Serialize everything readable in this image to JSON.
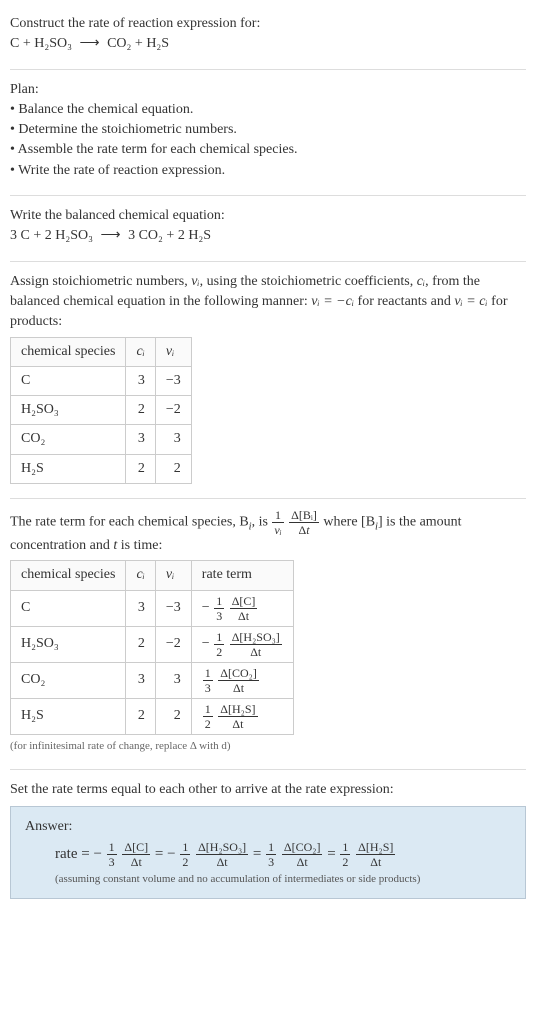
{
  "intro": {
    "title": "Construct the rate of reaction expression for:",
    "equation_lhs": "C + H₂SO₃",
    "equation_rhs": "CO₂ + H₂S"
  },
  "plan": {
    "heading": "Plan:",
    "items": [
      "Balance the chemical equation.",
      "Determine the stoichiometric numbers.",
      "Assemble the rate term for each chemical species.",
      "Write the rate of reaction expression."
    ]
  },
  "balanced": {
    "heading": "Write the balanced chemical equation:",
    "equation_lhs": "3 C + 2 H₂SO₃",
    "equation_rhs": "3 CO₂ + 2 H₂S"
  },
  "stoich": {
    "intro_a": "Assign stoichiometric numbers, ",
    "intro_b": ", using the stoichiometric coefficients, ",
    "intro_c": ", from the balanced chemical equation in the following manner: ",
    "intro_d": " for reactants and ",
    "intro_e": " for products:",
    "table": {
      "h1": "chemical species",
      "h2": "cᵢ",
      "h3": "νᵢ",
      "rows": [
        {
          "sp": "C",
          "c": "3",
          "v": "−3"
        },
        {
          "sp": "H₂SO₃",
          "c": "2",
          "v": "−2"
        },
        {
          "sp": "CO₂",
          "c": "3",
          "v": "3"
        },
        {
          "sp": "H₂S",
          "c": "2",
          "v": "2"
        }
      ]
    }
  },
  "rateterm": {
    "intro_a": "The rate term for each chemical species, B",
    "intro_b": ", is ",
    "intro_c": " where [B",
    "intro_d": "] is the amount concentration and ",
    "intro_e": " is time:",
    "table": {
      "h1": "chemical species",
      "h2": "cᵢ",
      "h3": "νᵢ",
      "h4": "rate term",
      "rows": [
        {
          "sp": "C",
          "c": "3",
          "v": "−3",
          "sign": "−",
          "coef": "3",
          "delta": "Δ[C]"
        },
        {
          "sp": "H₂SO₃",
          "c": "2",
          "v": "−2",
          "sign": "−",
          "coef": "2",
          "delta": "Δ[H₂SO₃]"
        },
        {
          "sp": "CO₂",
          "c": "3",
          "v": "3",
          "sign": "",
          "coef": "3",
          "delta": "Δ[CO₂]"
        },
        {
          "sp": "H₂S",
          "c": "2",
          "v": "2",
          "sign": "",
          "coef": "2",
          "delta": "Δ[H₂S]"
        }
      ]
    },
    "note": "(for infinitesimal rate of change, replace Δ with d)"
  },
  "final": {
    "heading": "Set the rate terms equal to each other to arrive at the rate expression:",
    "answer_label": "Answer:",
    "rate_prefix": "rate = ",
    "terms": [
      {
        "sign": "−",
        "coef": "3",
        "delta": "Δ[C]"
      },
      {
        "sign": "−",
        "coef": "2",
        "delta": "Δ[H₂SO₃]"
      },
      {
        "sign": "",
        "coef": "3",
        "delta": "Δ[CO₂]"
      },
      {
        "sign": "",
        "coef": "2",
        "delta": "Δ[H₂S]"
      }
    ],
    "note": "(assuming constant volume and no accumulation of intermediates or side products)"
  },
  "sym": {
    "nu_i": "νᵢ",
    "c_i": "cᵢ",
    "eq1": "νᵢ = −cᵢ",
    "eq2": "νᵢ = cᵢ",
    "i": "i",
    "t": "t",
    "one": "1",
    "dt": "Δt",
    "dBi": "Δ[Bᵢ]",
    "eq": " = "
  }
}
